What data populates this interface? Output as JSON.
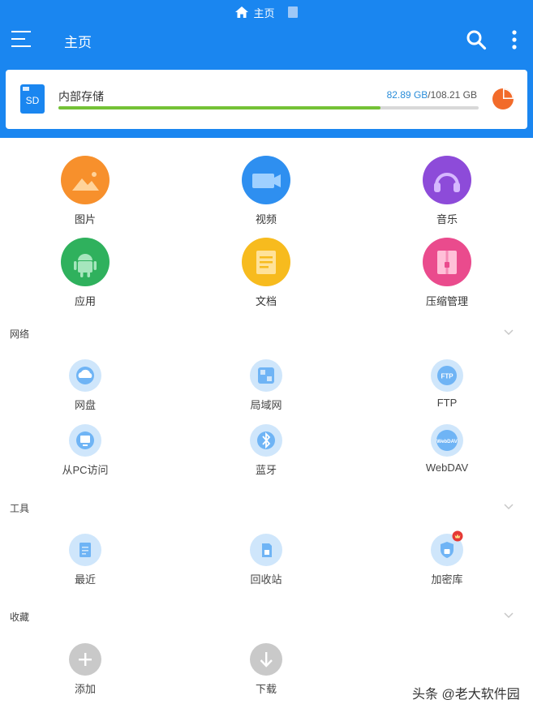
{
  "header": {
    "path": "主页",
    "title": "主页"
  },
  "storage": {
    "label": "内部存储",
    "sd_label": "SD",
    "used": "82.89 GB",
    "separator": "/",
    "total": "108.21 GB",
    "used_fraction": 0.766
  },
  "categories": [
    {
      "label": "图片",
      "icon": "image-icon",
      "color": "#f7902c"
    },
    {
      "label": "视频",
      "icon": "video-icon",
      "color": "#2e8ff0"
    },
    {
      "label": "音乐",
      "icon": "headphones-icon",
      "color": "#8d4bd9"
    },
    {
      "label": "应用",
      "icon": "android-icon",
      "color": "#2fb15d"
    },
    {
      "label": "文档",
      "icon": "document-icon",
      "color": "#f7bb1e"
    },
    {
      "label": "压缩管理",
      "icon": "archive-icon",
      "color": "#ea4b8d"
    }
  ],
  "network": {
    "title": "网络",
    "items": [
      {
        "label": "网盘",
        "icon": "cloud-icon"
      },
      {
        "label": "局域网",
        "icon": "lan-icon"
      },
      {
        "label": "FTP",
        "icon": "ftp-icon",
        "badge": "FTP"
      },
      {
        "label": "从PC访问",
        "icon": "monitor-icon"
      },
      {
        "label": "蓝牙",
        "icon": "bluetooth-icon"
      },
      {
        "label": "WebDAV",
        "icon": "webdav-icon",
        "badge": "WebDAV"
      }
    ]
  },
  "tools": {
    "title": "工具",
    "items": [
      {
        "label": "最近",
        "icon": "recent-icon"
      },
      {
        "label": "回收站",
        "icon": "recycle-bin-icon"
      },
      {
        "label": "加密库",
        "icon": "shield-lock-icon"
      }
    ]
  },
  "favorites": {
    "title": "收藏",
    "items": [
      {
        "label": "添加",
        "icon": "add-icon"
      },
      {
        "label": "下载",
        "icon": "download-icon"
      }
    ]
  },
  "watermark": "头条 @老大软件园"
}
